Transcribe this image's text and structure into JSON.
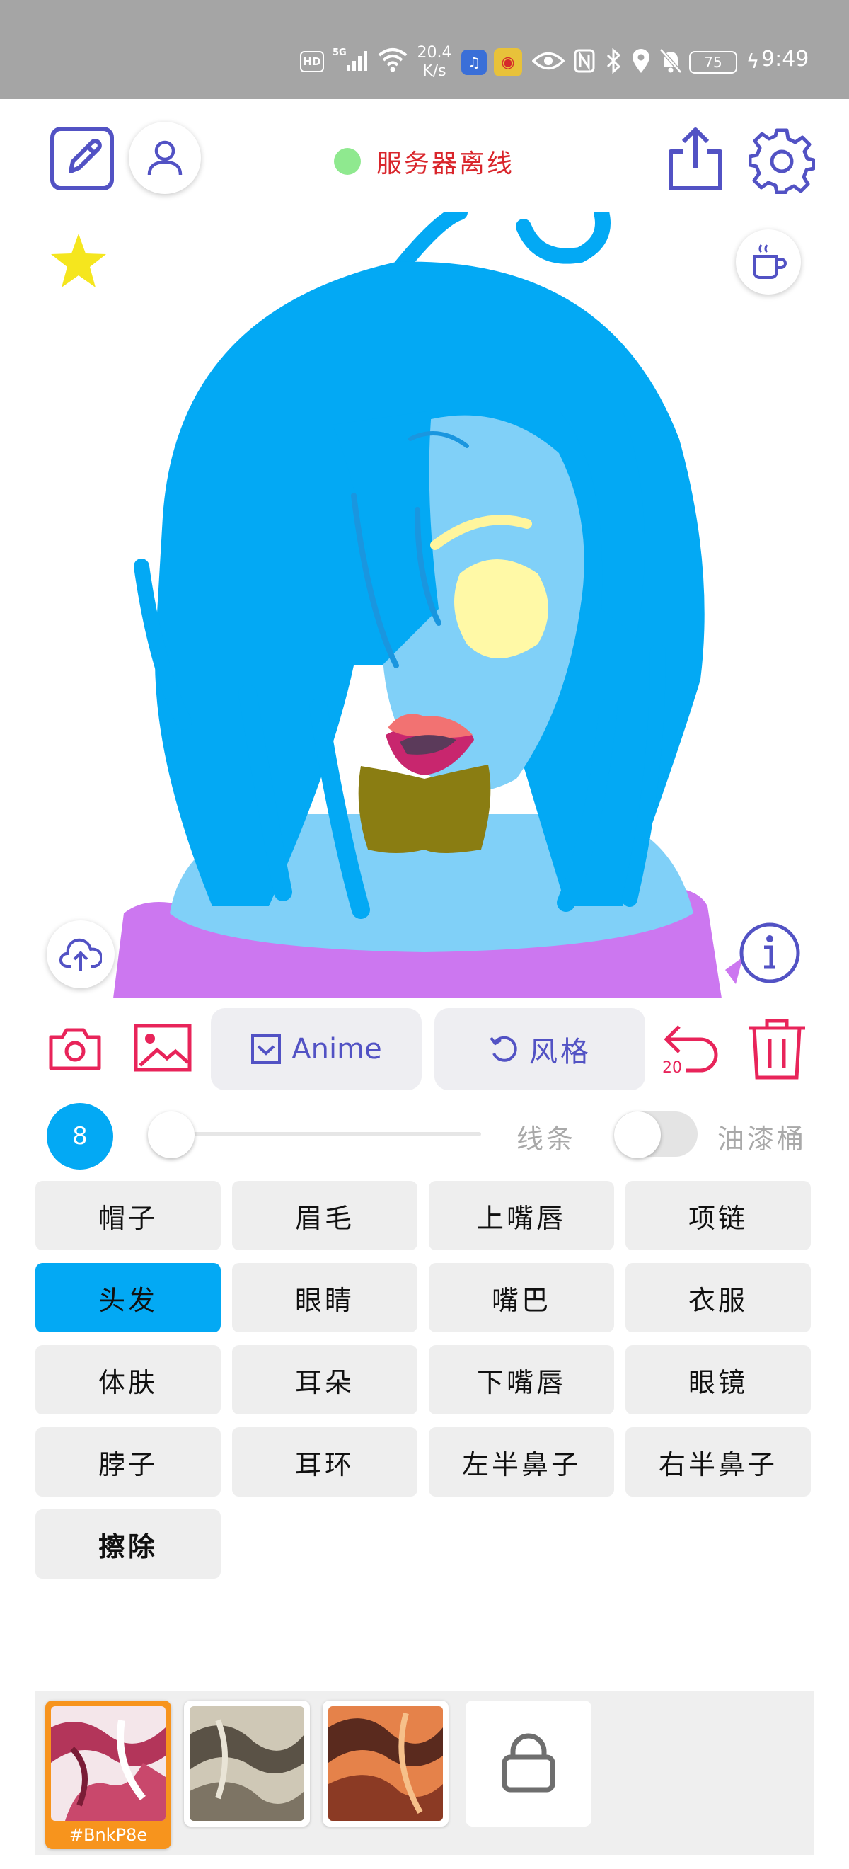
{
  "status_bar": {
    "hd": "HD",
    "network": "5G",
    "speed_value": "20.4",
    "speed_unit": "K/s",
    "battery": "75",
    "time": "9:49"
  },
  "header": {
    "server_status": "服务器离线",
    "server_status_color": "#8fe98f"
  },
  "tools": {
    "anime_label": "Anime",
    "style_label": "风格",
    "undo_count": "20"
  },
  "brush": {
    "size": "8",
    "size_level": 0.05,
    "line_label": "线条",
    "bucket_label": "油漆桶",
    "bucket_enabled": false
  },
  "parts": [
    {
      "label": "帽子"
    },
    {
      "label": "眉毛"
    },
    {
      "label": "上嘴唇"
    },
    {
      "label": "项链"
    },
    {
      "label": "头发",
      "active": true
    },
    {
      "label": "眼睛"
    },
    {
      "label": "嘴巴"
    },
    {
      "label": "衣服"
    },
    {
      "label": "体肤"
    },
    {
      "label": "耳朵"
    },
    {
      "label": "下嘴唇"
    },
    {
      "label": "眼镜"
    },
    {
      "label": "脖子"
    },
    {
      "label": "耳环"
    },
    {
      "label": "左半鼻子"
    },
    {
      "label": "右半鼻子"
    },
    {
      "label": "擦除",
      "bold": true
    }
  ],
  "styles": {
    "selected_code": "#BnkP8e"
  },
  "colors": {
    "accent_purple": "#5252c4",
    "accent_red": "#e8245a",
    "hair_blue": "#03a9f4",
    "skin_blue": "#80d0f8",
    "clothes_purple": "#cc77f0"
  }
}
